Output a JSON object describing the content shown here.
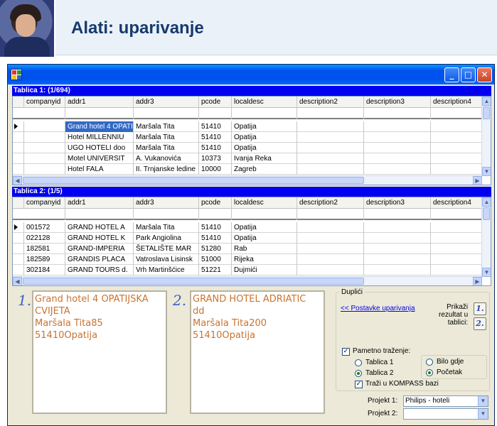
{
  "page": {
    "title": "Alati: uparivanje"
  },
  "window": {
    "minimize": "_",
    "maximize": "□",
    "close": "✕"
  },
  "columns": [
    "companyid",
    "addr1",
    "addr3",
    "pcode",
    "localdesc",
    "description2",
    "description3",
    "description4"
  ],
  "grid1": {
    "title": "Tablica 1: (1/694)",
    "rows": [
      [
        "",
        "Grand hotel 4 OPATI",
        "Maršala Tita",
        "51410",
        "Opatija",
        "",
        "",
        ""
      ],
      [
        "",
        "Hotel MILLENNIU",
        "Maršala Tita",
        "51410",
        "Opatija",
        "",
        "",
        ""
      ],
      [
        "",
        "UGO HOTELI doo",
        "Maršala Tita",
        "51410",
        "Opatija",
        "",
        "",
        ""
      ],
      [
        "",
        "Motel UNIVERSIT",
        "A. Vukanovića",
        "10373",
        "Ivanja Reka",
        "",
        "",
        ""
      ],
      [
        "",
        "Hotel FALA",
        "II. Trnjanske ledine",
        "10000",
        "Zagreb",
        "",
        "",
        ""
      ]
    ]
  },
  "grid2": {
    "title": "Tablica 2: (1/5)",
    "rows": [
      [
        "001572",
        "GRAND HOTEL A",
        "Maršala Tita",
        "51410",
        "Opatija",
        "",
        "",
        ""
      ],
      [
        "022128",
        "GRAND HOTEL K",
        "Park Angiolina",
        "51410",
        "Opatija",
        "",
        "",
        ""
      ],
      [
        "182581",
        "GRAND-IMPERIA",
        "ŠETALIŠTE MAR",
        "51280",
        "Rab",
        "",
        "",
        ""
      ],
      [
        "182589",
        "GRANDIS PLACA",
        "Vatroslava Lisinsk",
        "51000",
        "Rijeka",
        "",
        "",
        ""
      ],
      [
        "302184",
        "GRAND TOURS d.",
        "Vrh Martinšćice",
        "51221",
        "Dujmići",
        "",
        "",
        ""
      ]
    ]
  },
  "record1": {
    "number": "1.",
    "lines": [
      "Grand hotel 4 OPATIJSKA",
      "CVIJETA",
      "Maršala Tita85",
      "51410Opatija"
    ]
  },
  "record2": {
    "number": "2.",
    "lines": [
      "GRAND HOTEL ADRIATIC",
      "dd",
      "Maršala Tita200",
      "51410Opatija"
    ]
  },
  "duplicates": {
    "title": "Duplići",
    "settings_link": "<< Postavke uparivanja",
    "show_label": [
      "Prikaži",
      "rezultat u",
      "tablici:"
    ],
    "btn1": "1.",
    "btn2": "2.",
    "smart_search": "Pametno traženje:",
    "table1": "Tablica 1",
    "table2": "Tablica 2",
    "anywhere": "Bilo gdje",
    "start": "Početak",
    "kompass": "Traži u KOMPASS bazi"
  },
  "project1": {
    "label": "Projekt 1:",
    "value": "Philips - hoteli"
  },
  "project2": {
    "label": "Projekt 2:",
    "value": ""
  },
  "colors": {
    "accent": "#0000f0",
    "addr_text": "#c9732f",
    "title": "#153a6e"
  }
}
